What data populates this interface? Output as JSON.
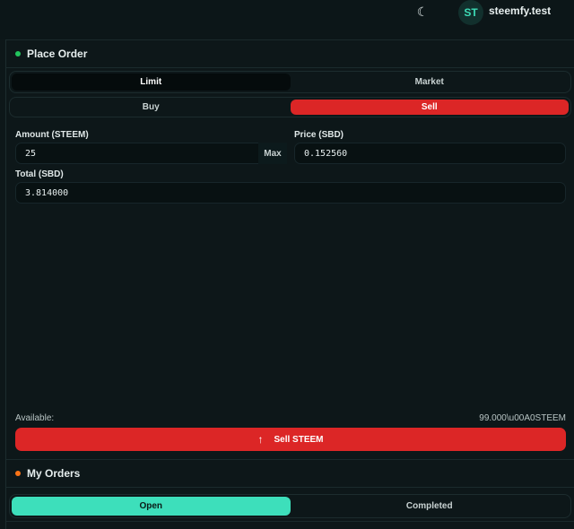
{
  "header": {
    "theme_icon": "moon-icon",
    "avatar_initials": "ST",
    "username": "steemfy.test"
  },
  "place_order": {
    "title": "Place Order",
    "dot_color": "#22c55e",
    "order_types": [
      "Limit",
      "Market"
    ],
    "order_type_selected": "Limit",
    "sides": [
      "Buy",
      "Sell"
    ],
    "side_selected": "Sell",
    "amount_label": "Amount (STEEM)",
    "amount_value": "25",
    "max_label": "Max",
    "price_label": "Price (SBD)",
    "price_value": "0.152560",
    "total_label": "Total (SBD)",
    "total_value": "3.814000",
    "available_label": "Available:",
    "available_value": "99.000\\u00A0STEEM",
    "submit_icon": "arrow-up-icon",
    "submit_label": "Sell STEEM",
    "submit_color": "#dc2626"
  },
  "my_orders": {
    "title": "My Orders",
    "dot_color": "#f97316",
    "tabs": [
      "Open",
      "Completed"
    ],
    "tab_selected": "Open",
    "accent": "#3ddfbb"
  }
}
